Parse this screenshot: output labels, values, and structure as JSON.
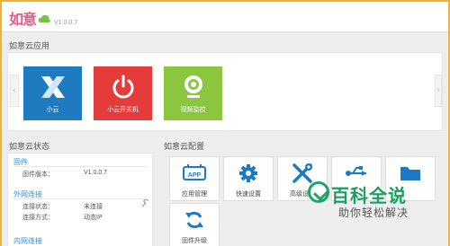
{
  "header": {
    "logo_text": "如意",
    "version": "V1.0.0.7"
  },
  "apps": {
    "title": "如意云应用",
    "tiles": [
      {
        "label": "小云",
        "color": "#1f7bbf"
      },
      {
        "label": "小云开关机",
        "color": "#e63b3b"
      },
      {
        "label": "视频监控",
        "color": "#8cc63f"
      }
    ]
  },
  "status": {
    "title": "如意云状态",
    "firmware": {
      "title": "固件",
      "version_label": "固件版本：",
      "version_value": "V1.0.0.7"
    },
    "wan": {
      "title": "外网连接",
      "state_label": "连接状态：",
      "state_value": "未连接",
      "mode_label": "连接方式：",
      "mode_value": "动态IP"
    },
    "lan": {
      "title": "内网连接"
    }
  },
  "config": {
    "title": "如意云配置",
    "tiles": [
      {
        "label": "应用管理",
        "icon": "app-icon"
      },
      {
        "label": "快速设置",
        "icon": "gear-icon"
      },
      {
        "label": "高级设置",
        "icon": "tools-icon"
      },
      {
        "label": "",
        "icon": "usb-icon"
      },
      {
        "label": "",
        "icon": "folder-icon"
      },
      {
        "label": "固件升级",
        "icon": "refresh-icon"
      }
    ],
    "icon_color": "#1a7bc4"
  },
  "watermark": {
    "title": "百科全说",
    "subtitle": "助你轻松解决",
    "color": "#1b9e5f"
  }
}
